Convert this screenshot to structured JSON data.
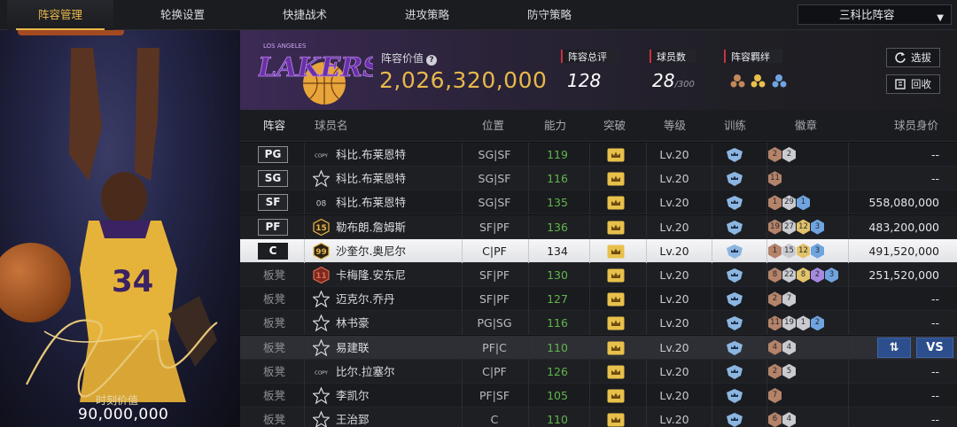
{
  "nav": {
    "tabs": [
      "阵容管理",
      "轮换设置",
      "快捷战术",
      "进攻策略",
      "防守策略"
    ],
    "active_tab": "阵容管理",
    "lineup_select": "三科比阵容"
  },
  "hero": {
    "moment_label": "时刻价值",
    "moment_value": "90,000,000",
    "jersey": "34"
  },
  "team": {
    "logo_text": "LAKERS",
    "logo_sub": "LOS ANGELES",
    "value_label": "阵容价值",
    "value": "2,026,320,000",
    "rating_label": "阵容总评",
    "rating": "128",
    "players_label": "球员数",
    "players": "28",
    "players_max": "/300",
    "bond_label": "阵容羁绊",
    "select_button": "选拔",
    "recycle_button": "回收"
  },
  "table": {
    "headers": [
      "阵容",
      "球员名",
      "位置",
      "能力",
      "突破",
      "等级",
      "训练",
      "徽章",
      "球员身价"
    ],
    "rows": [
      {
        "slot": "PG",
        "bench": false,
        "rank": "COPY",
        "rank_type": "copy",
        "name": "科比.布莱恩特",
        "pos": "SG|SF",
        "ability": "119",
        "level": "Lv.20",
        "medals": [
          {
            "v": "2",
            "c": "bronze"
          },
          {
            "v": "2",
            "c": "silver"
          }
        ],
        "worth": "--"
      },
      {
        "slot": "SG",
        "bench": false,
        "rank": "",
        "rank_type": "star",
        "name": "科比.布莱恩特",
        "pos": "SG|SF",
        "ability": "116",
        "level": "Lv.20",
        "medals": [
          {
            "v": "11",
            "c": "bronze"
          }
        ],
        "worth": "--"
      },
      {
        "slot": "SF",
        "bench": false,
        "rank": "08",
        "rank_type": "num",
        "name": "科比.布莱恩特",
        "pos": "SG|SF",
        "ability": "135",
        "level": "Lv.20",
        "medals": [
          {
            "v": "1",
            "c": "bronze"
          },
          {
            "v": "29",
            "c": "silver"
          },
          {
            "v": "1",
            "c": "blue"
          }
        ],
        "worth": "558,080,000"
      },
      {
        "slot": "PF",
        "bench": false,
        "rank": "15",
        "rank_type": "gold",
        "name": "勒布朗.詹姆斯",
        "pos": "SF|PF",
        "ability": "136",
        "level": "Lv.20",
        "medals": [
          {
            "v": "19",
            "c": "bronze"
          },
          {
            "v": "27",
            "c": "silver"
          },
          {
            "v": "12",
            "c": "gold"
          },
          {
            "v": "3",
            "c": "blue"
          }
        ],
        "worth": "483,200,000"
      },
      {
        "slot": "C",
        "bench": false,
        "rank": "99",
        "rank_type": "gold",
        "name": "沙奎尔.奥尼尔",
        "pos": "C|PF",
        "ability": "134",
        "level": "Lv.20",
        "medals": [
          {
            "v": "1",
            "c": "bronze"
          },
          {
            "v": "15",
            "c": "silver"
          },
          {
            "v": "12",
            "c": "gold"
          },
          {
            "v": "3",
            "c": "blue"
          }
        ],
        "worth": "491,520,000"
      },
      {
        "slot": "板凳",
        "bench": true,
        "rank": "11",
        "rank_type": "red",
        "name": "卡梅隆.安东尼",
        "pos": "SF|PF",
        "ability": "130",
        "level": "Lv.20",
        "medals": [
          {
            "v": "8",
            "c": "bronze"
          },
          {
            "v": "22",
            "c": "silver"
          },
          {
            "v": "8",
            "c": "gold"
          },
          {
            "v": "2",
            "c": "purple"
          },
          {
            "v": "3",
            "c": "blue"
          }
        ],
        "worth": "251,520,000"
      },
      {
        "slot": "板凳",
        "bench": true,
        "rank": "",
        "rank_type": "star",
        "name": "迈克尔.乔丹",
        "pos": "SF|PF",
        "ability": "127",
        "level": "Lv.20",
        "medals": [
          {
            "v": "2",
            "c": "bronze"
          },
          {
            "v": "7",
            "c": "silver"
          }
        ],
        "worth": "--"
      },
      {
        "slot": "板凳",
        "bench": true,
        "rank": "",
        "rank_type": "star",
        "name": "林书豪",
        "pos": "PG|SG",
        "ability": "116",
        "level": "Lv.20",
        "medals": [
          {
            "v": "11",
            "c": "bronze"
          },
          {
            "v": "19",
            "c": "silver"
          },
          {
            "v": "1",
            "c": "silver"
          },
          {
            "v": "2",
            "c": "blue"
          }
        ],
        "worth": "--"
      },
      {
        "slot": "板凳",
        "bench": true,
        "rank": "",
        "rank_type": "star",
        "name": "易建联",
        "pos": "PF|C",
        "ability": "110",
        "level": "Lv.20",
        "medals": [
          {
            "v": "4",
            "c": "bronze"
          },
          {
            "v": "4",
            "c": "silver"
          }
        ],
        "worth": ""
      },
      {
        "slot": "板凳",
        "bench": true,
        "rank": "COPY",
        "rank_type": "copy",
        "name": "比尔.拉塞尔",
        "pos": "C|PF",
        "ability": "126",
        "level": "Lv.20",
        "medals": [
          {
            "v": "2",
            "c": "bronze"
          },
          {
            "v": "5",
            "c": "silver"
          }
        ],
        "worth": "--"
      },
      {
        "slot": "板凳",
        "bench": true,
        "rank": "",
        "rank_type": "star",
        "name": "李凯尔",
        "pos": "PF|SF",
        "ability": "105",
        "level": "Lv.20",
        "medals": [
          {
            "v": "7",
            "c": "bronze"
          }
        ],
        "worth": "--"
      },
      {
        "slot": "板凳",
        "bench": true,
        "rank": "",
        "rank_type": "star",
        "name": "王治郅",
        "pos": "C",
        "ability": "110",
        "level": "Lv.20",
        "medals": [
          {
            "v": "6",
            "c": "bronze"
          },
          {
            "v": "4",
            "c": "silver"
          }
        ],
        "worth": "--"
      }
    ],
    "selected_index": 4,
    "hover_index": 8,
    "swap_label": "⇅",
    "vs_label": "VS"
  },
  "colors": {
    "accent": "#e8b84a",
    "ability_green": "#5fb64a",
    "crown_gold": "#e8c04a",
    "train_blue": "#8cb6e2"
  }
}
